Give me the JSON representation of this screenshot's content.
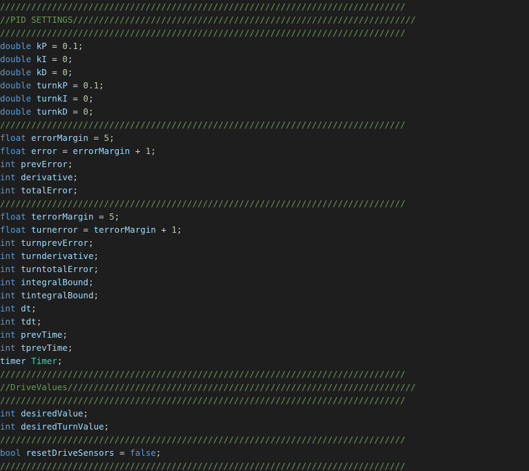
{
  "colors": {
    "background": "#1e1e1e",
    "comment": "#6a9955",
    "keyword": "#569cd6",
    "type": "#4ec9b0",
    "variable": "#9cdcfe",
    "number": "#b5cea8",
    "plain": "#d4d4d4"
  },
  "lines": [
    [
      [
        "comment",
        "//////////////////////////////////////////////////////////////////////////////"
      ]
    ],
    [
      [
        "comment",
        "//PID SETTINGS//////////////////////////////////////////////////////////////////"
      ]
    ],
    [
      [
        "comment",
        "//////////////////////////////////////////////////////////////////////////////"
      ]
    ],
    [
      [
        "keyword",
        "double"
      ],
      [
        "plain",
        " "
      ],
      [
        "var",
        "kP"
      ],
      [
        "plain",
        " = "
      ],
      [
        "num",
        "0.1"
      ],
      [
        "plain",
        ";"
      ]
    ],
    [
      [
        "keyword",
        "double"
      ],
      [
        "plain",
        " "
      ],
      [
        "var",
        "kI"
      ],
      [
        "plain",
        " = "
      ],
      [
        "num",
        "0"
      ],
      [
        "plain",
        ";"
      ]
    ],
    [
      [
        "keyword",
        "double"
      ],
      [
        "plain",
        " "
      ],
      [
        "var",
        "kD"
      ],
      [
        "plain",
        " = "
      ],
      [
        "num",
        "0"
      ],
      [
        "plain",
        ";"
      ]
    ],
    [
      [
        "keyword",
        "double"
      ],
      [
        "plain",
        " "
      ],
      [
        "var",
        "turnkP"
      ],
      [
        "plain",
        " = "
      ],
      [
        "num",
        "0.1"
      ],
      [
        "plain",
        ";"
      ]
    ],
    [
      [
        "keyword",
        "double"
      ],
      [
        "plain",
        " "
      ],
      [
        "var",
        "turnkI"
      ],
      [
        "plain",
        " = "
      ],
      [
        "num",
        "0"
      ],
      [
        "plain",
        ";"
      ]
    ],
    [
      [
        "keyword",
        "double"
      ],
      [
        "plain",
        " "
      ],
      [
        "var",
        "turnkD"
      ],
      [
        "plain",
        " = "
      ],
      [
        "num",
        "0"
      ],
      [
        "plain",
        ";"
      ]
    ],
    [
      [
        "comment",
        "//////////////////////////////////////////////////////////////////////////////"
      ]
    ],
    [
      [
        "keyword",
        "float"
      ],
      [
        "plain",
        " "
      ],
      [
        "var",
        "errorMargin"
      ],
      [
        "plain",
        " = "
      ],
      [
        "num",
        "5"
      ],
      [
        "plain",
        ";"
      ]
    ],
    [
      [
        "keyword",
        "float"
      ],
      [
        "plain",
        " "
      ],
      [
        "var",
        "error"
      ],
      [
        "plain",
        " = "
      ],
      [
        "var",
        "errorMargin"
      ],
      [
        "plain",
        " + "
      ],
      [
        "num",
        "1"
      ],
      [
        "plain",
        ";"
      ]
    ],
    [
      [
        "keyword",
        "int"
      ],
      [
        "plain",
        " "
      ],
      [
        "var",
        "prevError"
      ],
      [
        "plain",
        ";"
      ]
    ],
    [
      [
        "keyword",
        "int"
      ],
      [
        "plain",
        " "
      ],
      [
        "var",
        "derivative"
      ],
      [
        "plain",
        ";"
      ]
    ],
    [
      [
        "keyword",
        "int"
      ],
      [
        "plain",
        " "
      ],
      [
        "var",
        "totalError"
      ],
      [
        "plain",
        ";"
      ]
    ],
    [
      [
        "comment",
        "//////////////////////////////////////////////////////////////////////////////"
      ]
    ],
    [
      [
        "keyword",
        "float"
      ],
      [
        "plain",
        " "
      ],
      [
        "var",
        "terrorMargin"
      ],
      [
        "plain",
        " = "
      ],
      [
        "num",
        "5"
      ],
      [
        "plain",
        ";"
      ]
    ],
    [
      [
        "keyword",
        "float"
      ],
      [
        "plain",
        " "
      ],
      [
        "var",
        "turnerror"
      ],
      [
        "plain",
        " = "
      ],
      [
        "var",
        "terrorMargin"
      ],
      [
        "plain",
        " + "
      ],
      [
        "num",
        "1"
      ],
      [
        "plain",
        ";"
      ]
    ],
    [
      [
        "keyword",
        "int"
      ],
      [
        "plain",
        " "
      ],
      [
        "var",
        "turnprevError"
      ],
      [
        "plain",
        ";"
      ]
    ],
    [
      [
        "keyword",
        "int"
      ],
      [
        "plain",
        " "
      ],
      [
        "var",
        "turnderivative"
      ],
      [
        "plain",
        ";"
      ]
    ],
    [
      [
        "keyword",
        "int"
      ],
      [
        "plain",
        " "
      ],
      [
        "var",
        "turntotalError"
      ],
      [
        "plain",
        ";"
      ]
    ],
    [
      [
        "keyword",
        "int"
      ],
      [
        "plain",
        " "
      ],
      [
        "var",
        "integralBound"
      ],
      [
        "plain",
        ";"
      ]
    ],
    [
      [
        "keyword",
        "int"
      ],
      [
        "plain",
        " "
      ],
      [
        "var",
        "tintegralBound"
      ],
      [
        "plain",
        ";"
      ]
    ],
    [
      [
        "keyword",
        "int"
      ],
      [
        "plain",
        " "
      ],
      [
        "var",
        "dt"
      ],
      [
        "plain",
        ";"
      ]
    ],
    [
      [
        "keyword",
        "int"
      ],
      [
        "plain",
        " "
      ],
      [
        "var",
        "tdt"
      ],
      [
        "plain",
        ";"
      ]
    ],
    [
      [
        "keyword",
        "int"
      ],
      [
        "plain",
        " "
      ],
      [
        "var",
        "prevTime"
      ],
      [
        "plain",
        ";"
      ]
    ],
    [
      [
        "keyword",
        "int"
      ],
      [
        "plain",
        " "
      ],
      [
        "var",
        "tprevTime"
      ],
      [
        "plain",
        ";"
      ]
    ],
    [
      [
        "var",
        "timer"
      ],
      [
        "plain",
        " "
      ],
      [
        "type",
        "Timer"
      ],
      [
        "plain",
        ";"
      ]
    ],
    [
      [
        "comment",
        "//////////////////////////////////////////////////////////////////////////////"
      ]
    ],
    [
      [
        "comment",
        "//DriveValues///////////////////////////////////////////////////////////////////"
      ]
    ],
    [
      [
        "comment",
        "//////////////////////////////////////////////////////////////////////////////"
      ]
    ],
    [
      [
        "keyword",
        "int"
      ],
      [
        "plain",
        " "
      ],
      [
        "var",
        "desiredValue"
      ],
      [
        "plain",
        ";"
      ]
    ],
    [
      [
        "keyword",
        "int"
      ],
      [
        "plain",
        " "
      ],
      [
        "var",
        "desiredTurnValue"
      ],
      [
        "plain",
        ";"
      ]
    ],
    [
      [
        "comment",
        "//////////////////////////////////////////////////////////////////////////////"
      ]
    ],
    [
      [
        "keyword",
        "bool"
      ],
      [
        "plain",
        " "
      ],
      [
        "var",
        "resetDriveSensors"
      ],
      [
        "plain",
        " = "
      ],
      [
        "keyword",
        "false"
      ],
      [
        "plain",
        ";"
      ]
    ],
    [
      [
        "comment",
        "//////////////////////////////////////////////////////////////////////////////"
      ]
    ]
  ]
}
